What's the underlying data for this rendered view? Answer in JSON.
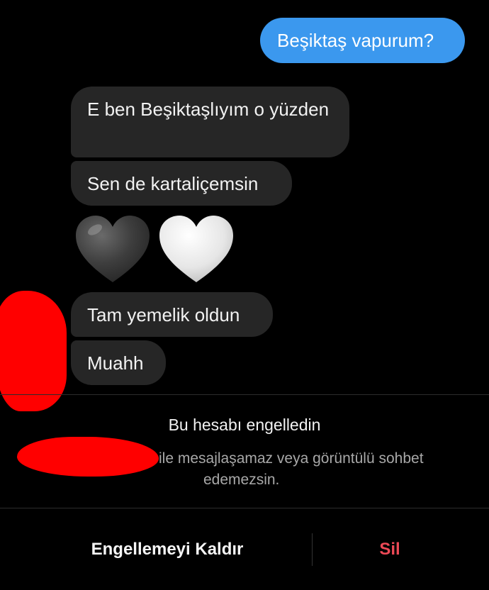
{
  "messages": {
    "sent": [
      "Beşiktaş vapurum?"
    ],
    "received": [
      "E ben Beşiktaşlıyım o yüzden",
      "Sen de kartaliçemsin",
      "Tam yemelik oldun",
      "Muahh"
    ],
    "emoji": [
      "black-heart-icon",
      "white-heart-icon"
    ]
  },
  "blocked_notice": {
    "title": "Bu hesabı engelledin",
    "description_line1": "ile mesajlaşamaz veya görüntülü sohbet",
    "description_line2": "edemezsin."
  },
  "actions": {
    "unblock_label": "Engellemeyi Kaldır",
    "delete_label": "Sil"
  },
  "colors": {
    "background": "#000000",
    "sent_bubble": "#3b98ee",
    "received_bubble": "#262626",
    "delete_text": "#ed4956",
    "redaction": "#ff0000"
  }
}
